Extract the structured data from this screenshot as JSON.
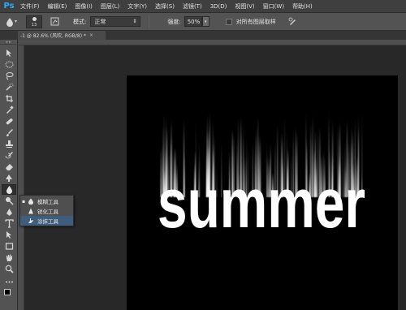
{
  "app": {
    "logo": "Ps"
  },
  "menu": [
    "文件(F)",
    "编辑(E)",
    "图像(I)",
    "图层(L)",
    "文字(Y)",
    "选择(S)",
    "滤镜(T)",
    "3D(D)",
    "视图(V)",
    "窗口(W)",
    "帮助(H)"
  ],
  "options": {
    "brush_size": "13",
    "mode_label": "模式:",
    "mode_value": "正常",
    "strength_label": "强度:",
    "strength_value": "50%",
    "sample_all_layers": "对所有图层取样",
    "sample_checked": false
  },
  "document": {
    "tab_title": "-1 @ 82.6% (风吹, RGB/8) *",
    "close": "×"
  },
  "canvas": {
    "text": "summer",
    "background": "#000000",
    "text_color": "#ffffff"
  },
  "flyout": {
    "items": [
      {
        "label": "模糊工具",
        "icon": "blur-drop-icon",
        "current": true,
        "selected": false
      },
      {
        "label": "锐化工具",
        "icon": "sharpen-triangle-icon",
        "current": false,
        "selected": false
      },
      {
        "label": "涂抹工具",
        "icon": "smudge-finger-icon",
        "current": false,
        "selected": true
      }
    ]
  },
  "toolbar": {
    "tools": [
      "move-tool-icon",
      "marquee-tool-icon",
      "lasso-tool-icon",
      "quick-select-tool-icon",
      "crop-tool-icon",
      "eyedropper-tool-icon",
      "healing-brush-tool-icon",
      "brush-tool-icon",
      "clone-stamp-tool-icon",
      "history-brush-tool-icon",
      "eraser-tool-icon",
      "gradient-tool-icon",
      "blur-tool-icon",
      "dodge-tool-icon",
      "pen-tool-icon",
      "type-tool-icon",
      "path-select-tool-icon",
      "shape-tool-icon",
      "hand-tool-icon",
      "zoom-tool-icon"
    ],
    "active": "blur-tool-icon"
  },
  "colors": {
    "accent": "#31a8ff",
    "selection": "#3f5e7d"
  }
}
